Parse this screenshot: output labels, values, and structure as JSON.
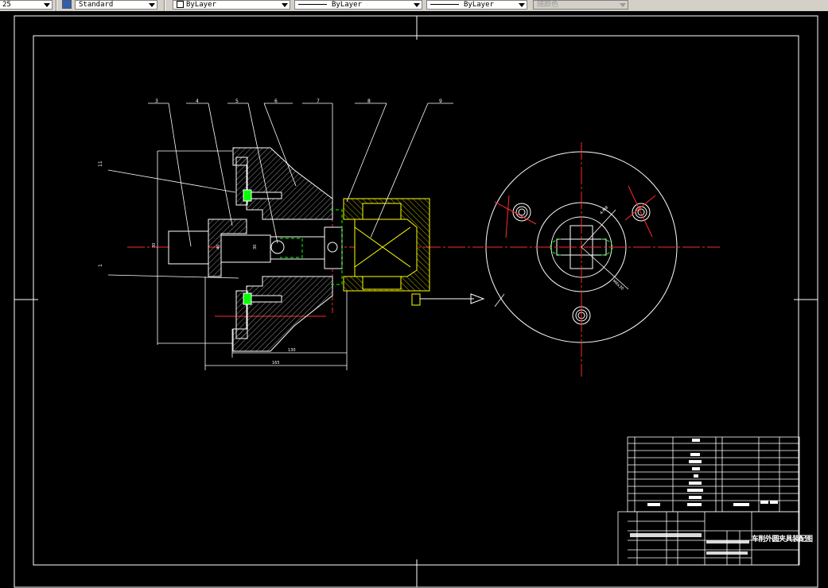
{
  "toolbar": {
    "scale": "25",
    "text_style": "Standard",
    "layer": "ByLayer",
    "linetype": "ByLayer",
    "lineweight": "ByLayer",
    "plot_color": "随颜色"
  },
  "drawing": {
    "balloons": [
      "3",
      "4",
      "5",
      "6",
      "7",
      "8",
      "9"
    ],
    "left_callouts": [
      "11",
      "1"
    ],
    "dims": {
      "d1": "130",
      "d2": "165",
      "d3": "30",
      "d4": "40",
      "d5": "30"
    },
    "radial_dims": [
      "4-M8",
      "M6x30"
    ]
  },
  "title_block": {
    "title": "车削外圆夹具装配图"
  },
  "colors": {
    "outline": "#ffffff",
    "centerline": "#ff2a2a",
    "yellow": "#ffff00",
    "green": "#00ff00",
    "hatch": "#b8b8b8"
  }
}
